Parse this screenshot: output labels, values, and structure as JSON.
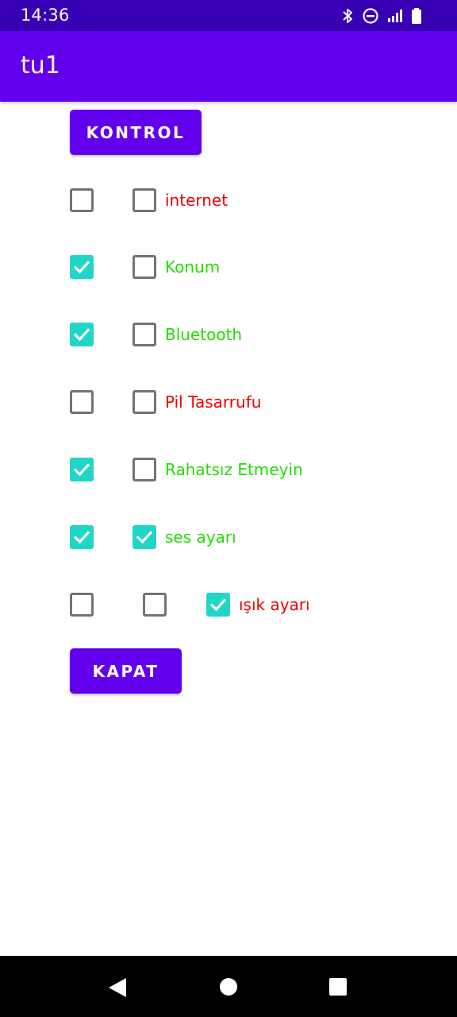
{
  "status_bar": {
    "time": "14:36",
    "icons": [
      "bluetooth-icon",
      "do-not-disturb-icon",
      "signal-icon",
      "battery-icon"
    ]
  },
  "app_bar": {
    "title": "tu1"
  },
  "buttons": {
    "kontrol": "KONTROL",
    "kapat": "KAPAT"
  },
  "rows": [
    {
      "label": "internet",
      "label_color": "#ee0000",
      "checks": [
        false,
        false
      ]
    },
    {
      "label": "Konum",
      "label_color": "#22dd00",
      "checks": [
        true,
        false
      ]
    },
    {
      "label": "Bluetooth",
      "label_color": "#22dd00",
      "checks": [
        true,
        false
      ]
    },
    {
      "label": "Pil Tasarrufu",
      "label_color": "#ee0000",
      "checks": [
        false,
        false
      ]
    },
    {
      "label": "Rahatsız Etmeyin",
      "label_color": "#22dd00",
      "checks": [
        true,
        false
      ]
    },
    {
      "label": "ses ayarı",
      "label_color": "#22dd00",
      "checks": [
        true,
        true
      ]
    },
    {
      "label": "ışık ayarı",
      "label_color": "#ee0000",
      "checks": [
        false,
        false,
        true
      ]
    }
  ],
  "colors": {
    "primary": "#6200ee",
    "primary_dark": "#3700b3",
    "checkbox_checked": "#20d6c6"
  },
  "nav_bar": {
    "icons": [
      "back-icon",
      "home-icon",
      "recents-icon"
    ]
  }
}
